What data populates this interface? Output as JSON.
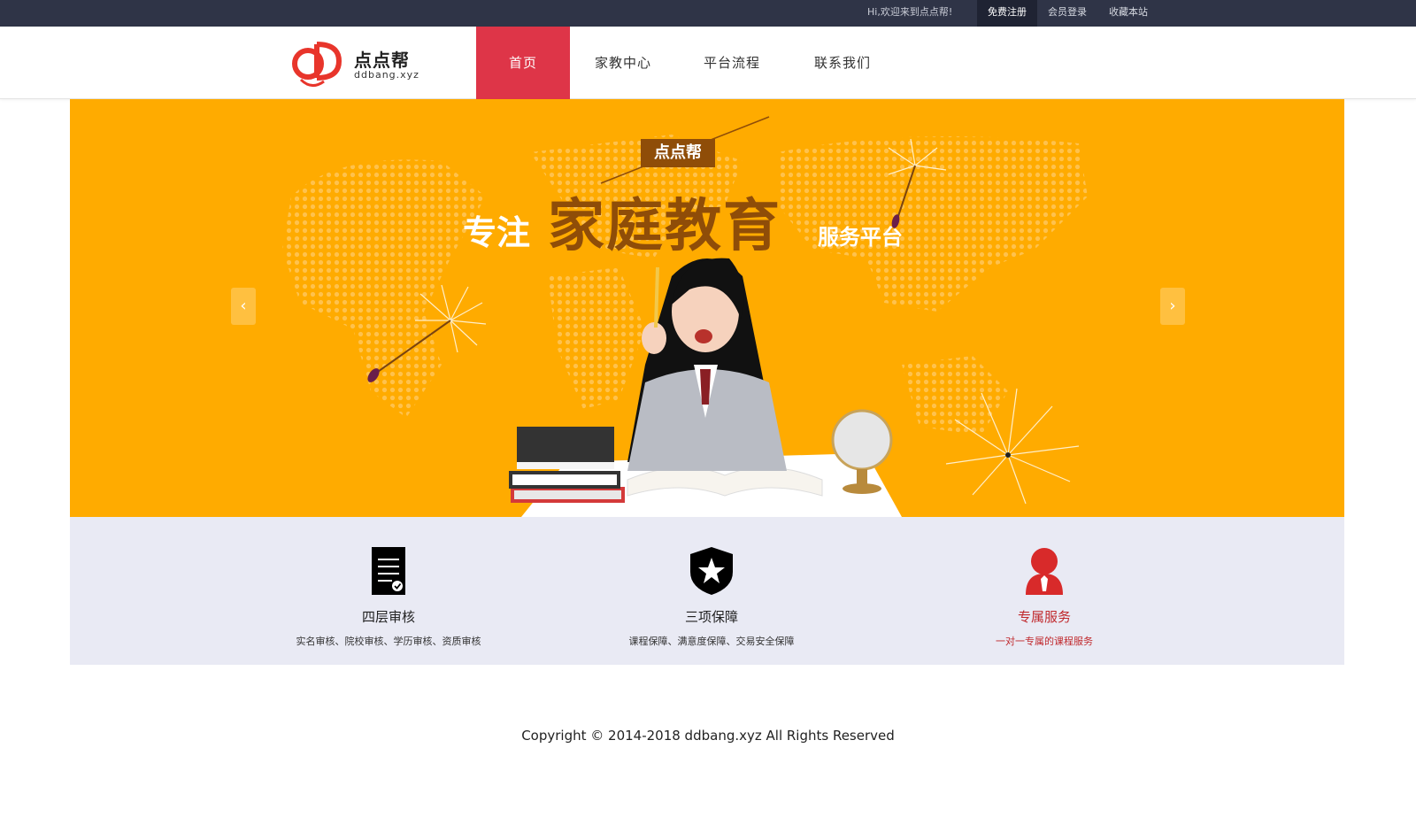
{
  "topbar": {
    "welcome": "Hi,欢迎来到点点帮!",
    "register": "免费注册",
    "login": "会员登录",
    "favorite": "收藏本站"
  },
  "logo": {
    "name": "点点帮",
    "domain": "ddbang.xyz",
    "colors": {
      "red": "#e8352b",
      "dark": "#222222"
    }
  },
  "nav": {
    "items": [
      {
        "label": "首页",
        "active": true
      },
      {
        "label": "家教中心",
        "active": false
      },
      {
        "label": "平台流程",
        "active": false
      },
      {
        "label": "联系我们",
        "active": false
      }
    ],
    "active_color": "#de3548"
  },
  "banner": {
    "tag": "点点帮",
    "slogan_prefix": "专注",
    "slogan_main": "家庭教育",
    "slogan_suffix": "服务平台",
    "prev_icon": "chevron-left-icon",
    "next_icon": "chevron-right-icon",
    "prev_glyph": "‹",
    "next_glyph": "›",
    "background": "#ffab00",
    "accent": "#8f4d08"
  },
  "features": [
    {
      "title": "四层审核",
      "desc": "实名审核、院校审核、学历审核、资质审核",
      "icon": "document-check-icon"
    },
    {
      "title": "三项保障",
      "desc": "课程保障、满意度保障、交易安全保障",
      "icon": "shield-star-icon"
    },
    {
      "title": "专属服务",
      "desc": "一对一专属的课程服务",
      "icon": "person-tie-icon"
    }
  ],
  "footer": {
    "copyright": "Copyright © 2014-2018 ddbang.xyz All Rights Reserved"
  }
}
